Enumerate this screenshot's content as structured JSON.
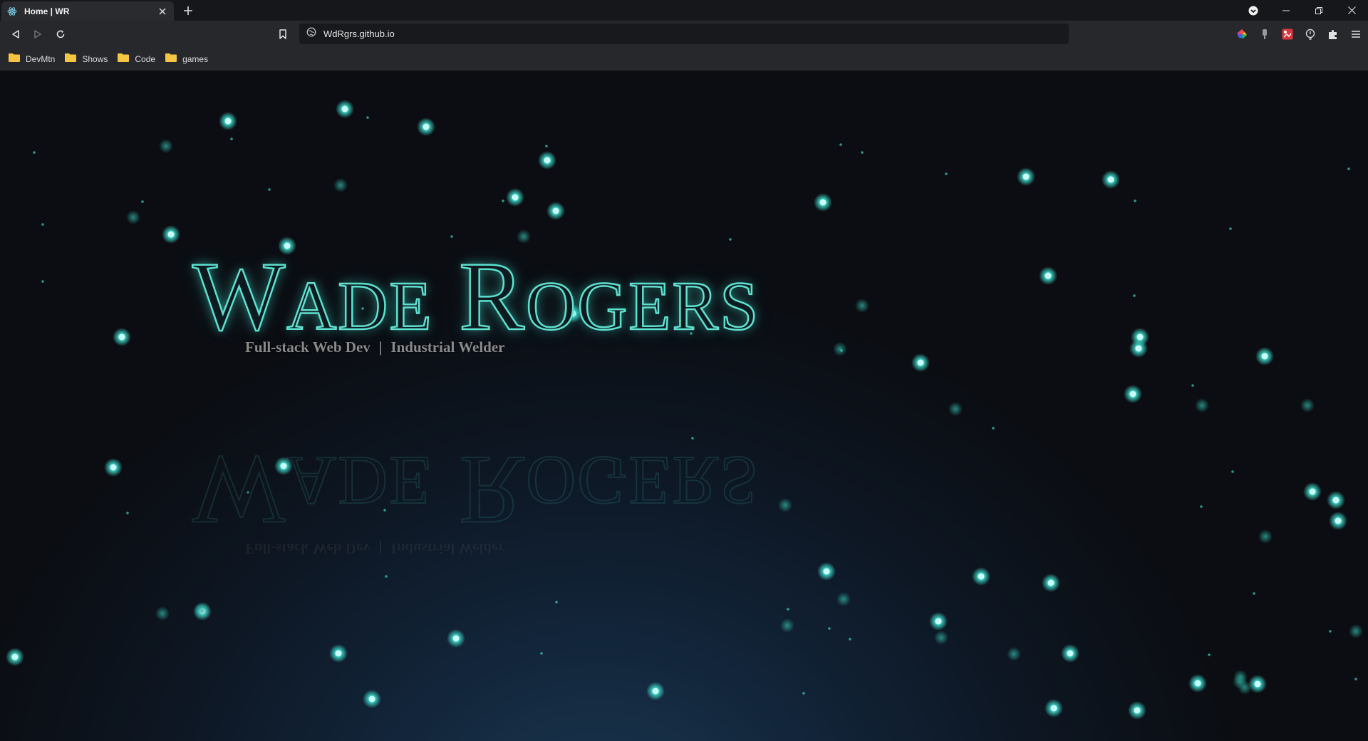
{
  "browser": {
    "tab": {
      "title": "Home | WR",
      "favicon": "react-icon"
    },
    "address": "WdRgrs.github.io",
    "window_controls": [
      "minimize-icon",
      "restore-icon",
      "close-icon"
    ],
    "extensions": [
      "colorful-extension-icon",
      "pin-extension-icon",
      "red-extension-icon",
      "lightbulb-extension-icon",
      "puzzle-icon",
      "menu-icon"
    ],
    "bookmarks": [
      {
        "label": "DevMtn"
      },
      {
        "label": "Shows"
      },
      {
        "label": "Code"
      },
      {
        "label": "games"
      }
    ]
  },
  "page": {
    "name": "Wade Rogers",
    "subtitle_left": "Full-stack Web Dev",
    "subtitle_sep": "|",
    "subtitle_right": "Industrial Welder",
    "accent": "#40e0d0",
    "background": "#0b0d12"
  }
}
